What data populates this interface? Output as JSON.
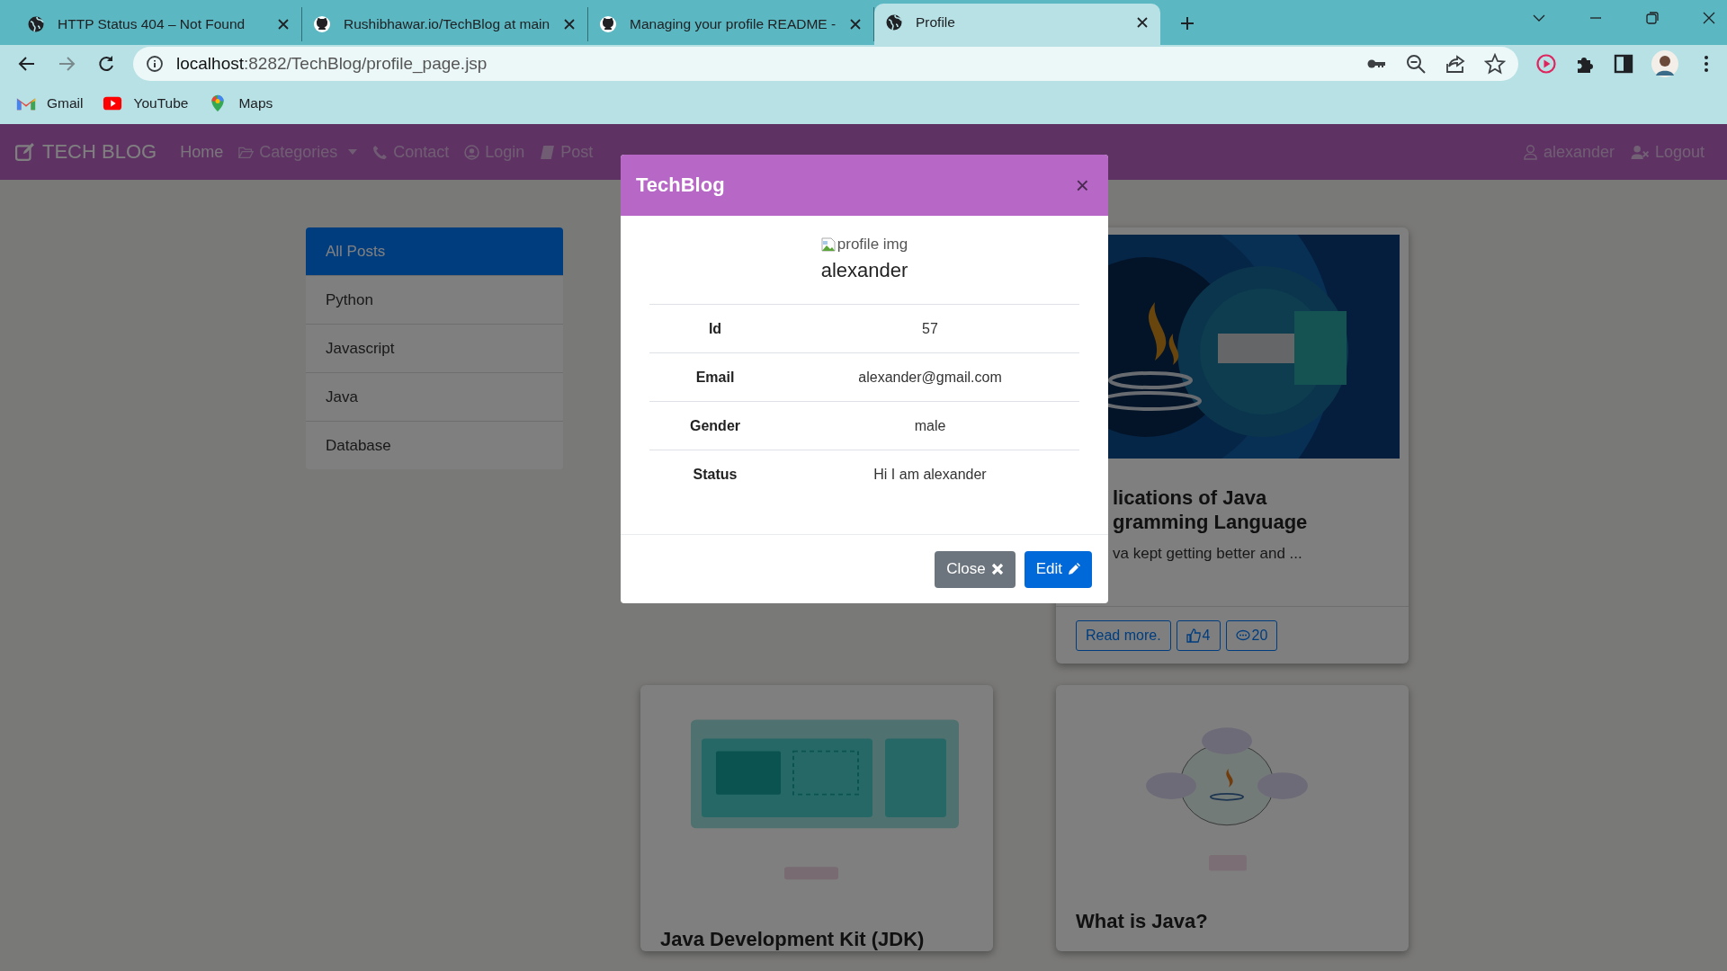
{
  "browser": {
    "tabs": [
      {
        "title": "HTTP Status 404 – Not Found",
        "kind": "page",
        "selected": false
      },
      {
        "title": "Rushibhawar.io/TechBlog at main",
        "kind": "repo",
        "selected": false
      },
      {
        "title": "Managing your profile README -",
        "kind": "repo",
        "selected": false
      },
      {
        "title": "Profile",
        "kind": "page",
        "selected": true
      }
    ],
    "address": {
      "host": "localhost",
      "rest": ":8282/TechBlog/profile_page.jsp"
    },
    "bookmarks": [
      {
        "label": "Gmail",
        "kind": "mail"
      },
      {
        "label": "YouTube",
        "kind": "video"
      },
      {
        "label": "Maps",
        "kind": "map"
      }
    ]
  },
  "navbar": {
    "brand": "TECH BLOG",
    "links": [
      {
        "label": "Home",
        "kind": "plain",
        "active": true
      },
      {
        "label": "Categories",
        "kind": "dropdown",
        "active": false
      },
      {
        "label": "Contact",
        "kind": "contact",
        "active": false
      },
      {
        "label": "Login",
        "kind": "login",
        "active": false
      },
      {
        "label": "Post",
        "kind": "post",
        "active": false
      }
    ],
    "user": "alexander",
    "logout": "Logout"
  },
  "sidebar": {
    "items": [
      {
        "label": "All Posts",
        "selected": true
      },
      {
        "label": "Python",
        "selected": false
      },
      {
        "label": "Javascript",
        "selected": false
      },
      {
        "label": "Java",
        "selected": false
      },
      {
        "label": "Database",
        "selected": false
      }
    ]
  },
  "posts": [
    {
      "kind": "full",
      "title_lines": [
        "lications of Java",
        "gramming Language"
      ],
      "excerpt": "va kept getting better and ...",
      "read_more": "Read more.",
      "likes": "4",
      "comments": "20"
    },
    {
      "kind": "title",
      "title": "Java Development Kit (JDK)"
    },
    {
      "kind": "title",
      "title": "What is Java?"
    }
  ],
  "modal": {
    "title": "TechBlog",
    "close_icon": "×",
    "image_alt": "profile img",
    "name": "alexander",
    "rows": [
      {
        "label": "Id",
        "value": "57"
      },
      {
        "label": "Email",
        "value": "alexander@gmail.com"
      },
      {
        "label": "Gender",
        "value": "male"
      },
      {
        "label": "Status",
        "value": "Hi I am alexander"
      }
    ],
    "buttons": [
      {
        "label": "Close",
        "kind": "secondary"
      },
      {
        "label": "Edit",
        "kind": "primary"
      }
    ]
  }
}
